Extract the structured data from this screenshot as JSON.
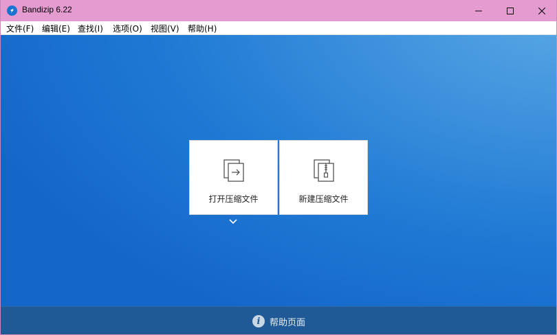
{
  "window": {
    "title": "Bandizip 6.22",
    "controls": {
      "minimize_icon": "minimize-icon",
      "maximize_icon": "maximize-icon",
      "close_icon": "close-icon"
    }
  },
  "menu": {
    "items": [
      {
        "label": "文件(F)"
      },
      {
        "label": "编辑(E)"
      },
      {
        "label": "查找(I)"
      },
      {
        "label": "选项(O)"
      },
      {
        "label": "视图(V)"
      },
      {
        "label": "帮助(H)"
      }
    ]
  },
  "main": {
    "tiles": [
      {
        "label": "打开压缩文件",
        "icon": "open-archive-icon"
      },
      {
        "label": "新建压缩文件",
        "icon": "new-archive-icon"
      }
    ],
    "dropdown_icon": "chevron-down-icon"
  },
  "footer": {
    "help_label": "帮助页面",
    "help_icon": "info-icon"
  },
  "colors": {
    "titlebar": "#e49bd0",
    "content_background": "#1f7ad4",
    "footer": "#1f5a96"
  }
}
